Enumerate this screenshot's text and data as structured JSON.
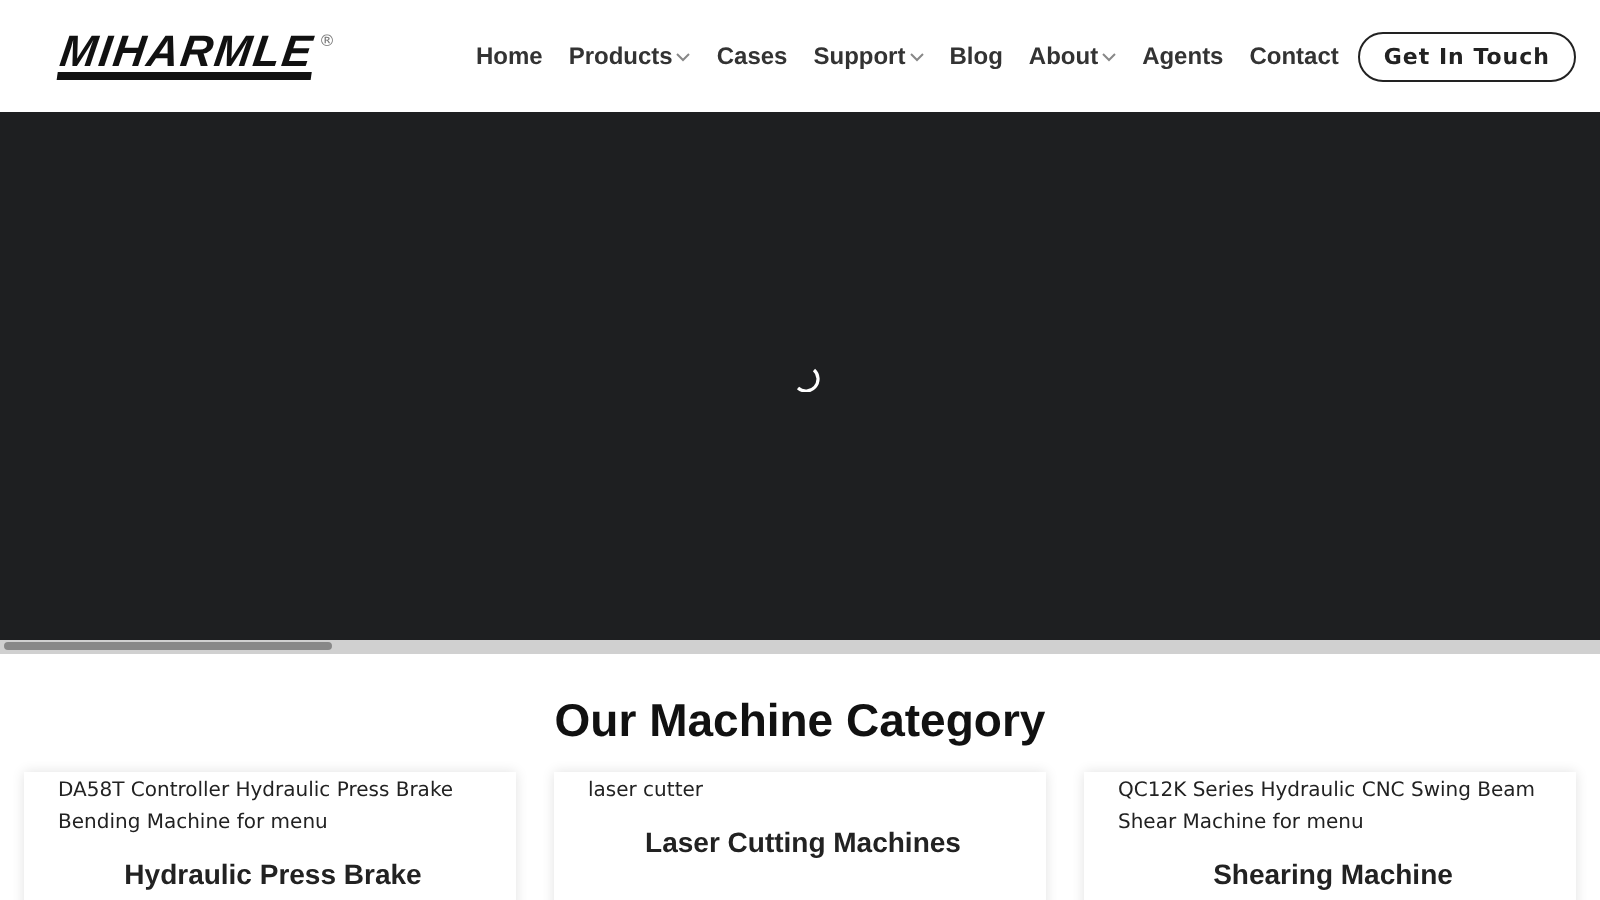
{
  "header": {
    "logo": {
      "text": "MIHARMLE",
      "mark": "®"
    },
    "nav": [
      {
        "label": "Home",
        "has_dropdown": false
      },
      {
        "label": "Products",
        "has_dropdown": true
      },
      {
        "label": "Cases",
        "has_dropdown": false
      },
      {
        "label": "Support",
        "has_dropdown": true
      },
      {
        "label": "Blog",
        "has_dropdown": false
      },
      {
        "label": "About",
        "has_dropdown": true
      },
      {
        "label": "Agents",
        "has_dropdown": false
      },
      {
        "label": "Contact",
        "has_dropdown": false
      }
    ],
    "cta": "Get In Touch"
  },
  "hero": {
    "loading": true
  },
  "section": {
    "title": "Our Machine Category",
    "cards": [
      {
        "image_alt": "DA58T Controller Hydraulic Press Brake Bending Machine for menu",
        "title": "Hydraulic Press Brake"
      },
      {
        "image_alt": "laser cutter",
        "title": "Laser Cutting Machines"
      },
      {
        "image_alt": "QC12K Series Hydraulic CNC Swing Beam Shear Machine for menu",
        "title": "Shearing Machine"
      }
    ]
  }
}
